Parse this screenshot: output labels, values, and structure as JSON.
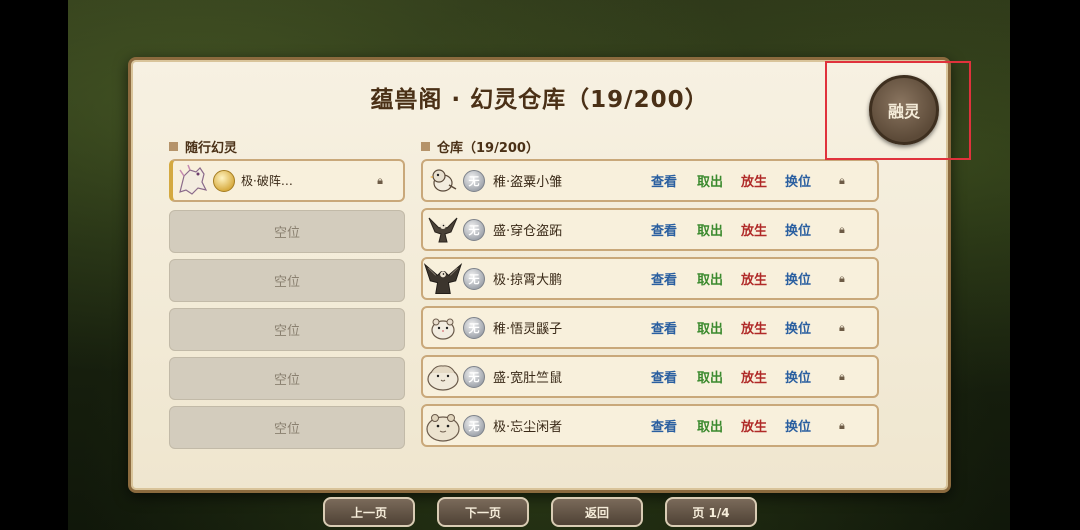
{
  "title": "蕴兽阁 · 幻灵仓库（19/200）",
  "fuse_button": "融灵",
  "companion": {
    "label": "随行幻灵",
    "slots": [
      {
        "name": "极·破阵…",
        "filled": true
      },
      {
        "name": "空位",
        "filled": false
      },
      {
        "name": "空位",
        "filled": false
      },
      {
        "name": "空位",
        "filled": false
      },
      {
        "name": "空位",
        "filled": false
      },
      {
        "name": "空位",
        "filled": false
      }
    ]
  },
  "warehouse": {
    "label": "仓库（19/200）",
    "badge": "无",
    "actions": {
      "view": "查看",
      "take": "取出",
      "free": "放生",
      "swap": "换位"
    },
    "items": [
      {
        "name": "稚·盗粟小雏",
        "icon": "sparrow-icon"
      },
      {
        "name": "盛·穿仓盗跖",
        "icon": "eagle-icon"
      },
      {
        "name": "极·掠霄大鹏",
        "icon": "big-eagle-icon"
      },
      {
        "name": "稚·悟灵鼷子",
        "icon": "hamster-icon"
      },
      {
        "name": "盛·宽肚竺鼠",
        "icon": "guinea-pig-icon"
      },
      {
        "name": "极·忘尘闲者",
        "icon": "fat-hamster-icon"
      }
    ]
  },
  "pager": {
    "prev": "上一页",
    "next": "下一页",
    "back": "返回",
    "page": "页 1/4"
  }
}
